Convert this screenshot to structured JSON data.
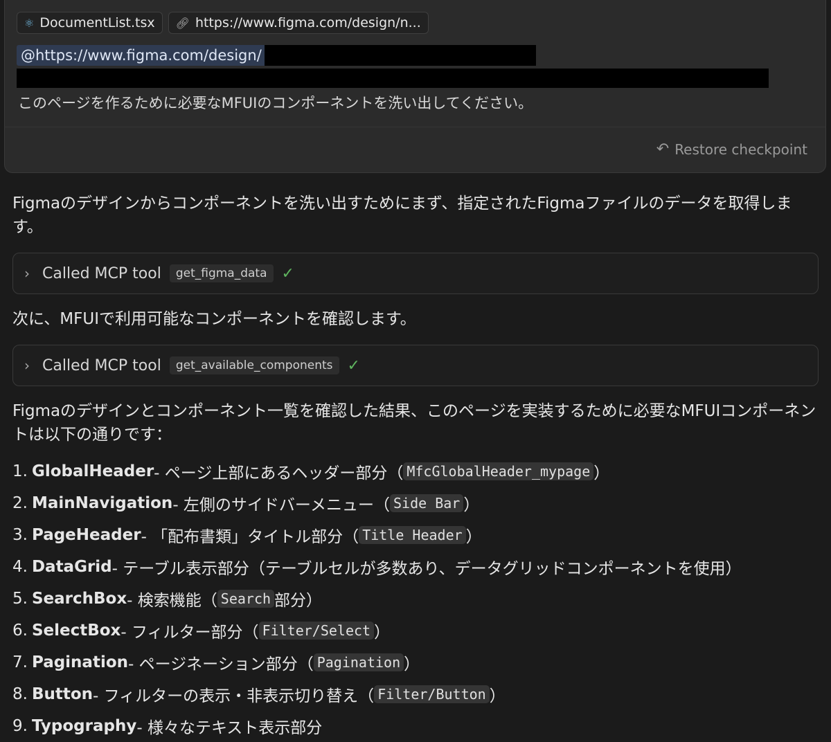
{
  "prompt": {
    "chips": [
      {
        "label": "DocumentList.tsx",
        "icon": "react-icon"
      },
      {
        "label": "https://www.figma.com/design/n...",
        "icon": "link-icon"
      }
    ],
    "mention": "@https://www.figma.com/design/",
    "text": "このページを作るために必要なMFUIのコンポーネントを洗い出してください。",
    "restore_label": "Restore checkpoint"
  },
  "response": {
    "intro": "Figmaのデザインからコンポーネントを洗い出すためにまず、指定されたFigmaファイルのデータを取得します。",
    "tool1": {
      "label": "Called MCP tool",
      "name": "get_figma_data"
    },
    "step2": "次に、MFUIで利用可能なコンポーネントを確認します。",
    "tool2": {
      "label": "Called MCP tool",
      "name": "get_available_components"
    },
    "summary": "Figmaのデザインとコンポーネント一覧を確認した結果、このページを実装するために必要なMFUIコンポーネントは以下の通りです：",
    "items": [
      {
        "num": "1.",
        "name": "GlobalHeader",
        "desc": " - ページ上部にあるヘッダー部分（",
        "code": "MfcGlobalHeader_mypage",
        "tail": "）"
      },
      {
        "num": "2.",
        "name": "MainNavigation",
        "desc": " - 左側のサイドバーメニュー（",
        "code": "Side Bar",
        "tail": "）"
      },
      {
        "num": "3.",
        "name": "PageHeader",
        "desc": " - 「配布書類」タイトル部分（",
        "code": "Title Header",
        "tail": "）"
      },
      {
        "num": "4.",
        "name": "DataGrid",
        "desc": " - テーブル表示部分（テーブルセルが多数あり、データグリッドコンポーネントを使用）",
        "code": "",
        "tail": ""
      },
      {
        "num": "5.",
        "name": "SearchBox",
        "desc": " - 検索機能（",
        "code": "Search",
        "tail": "部分）"
      },
      {
        "num": "6.",
        "name": "SelectBox",
        "desc": " - フィルター部分（",
        "code": "Filter/Select",
        "tail": "）"
      },
      {
        "num": "7.",
        "name": "Pagination",
        "desc": " - ページネーション部分（",
        "code": "Pagination",
        "tail": "）"
      },
      {
        "num": "8.",
        "name": "Button",
        "desc": " - フィルターの表示・非表示切り替え（",
        "code": "Filter/Button",
        "tail": "）"
      },
      {
        "num": "9.",
        "name": "Typography",
        "desc": " - 様々なテキスト表示部分",
        "code": "",
        "tail": ""
      }
    ]
  },
  "colors": {
    "background": "#1b1b1b",
    "card": "#2b2b2b",
    "check": "#5fb55f",
    "mention_bg": "#2f3b52"
  }
}
